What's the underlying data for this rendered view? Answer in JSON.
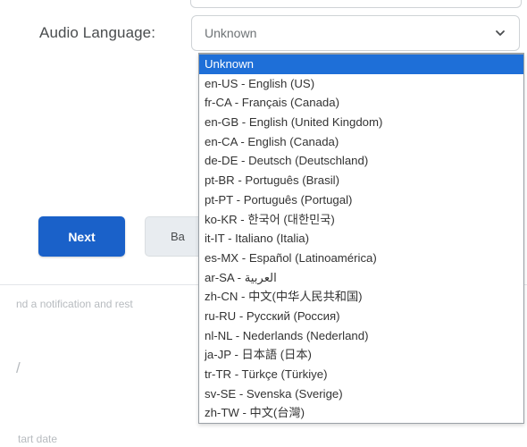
{
  "field": {
    "label": "Audio Language:",
    "selected_value": "Unknown"
  },
  "dropdown": {
    "options": [
      {
        "label": "Unknown",
        "selected": true
      },
      {
        "label": "en-US - English (US)"
      },
      {
        "label": "fr-CA - Français (Canada)"
      },
      {
        "label": "en-GB - English (United Kingdom)"
      },
      {
        "label": "en-CA - English (Canada)"
      },
      {
        "label": "de-DE - Deutsch (Deutschland)"
      },
      {
        "label": "pt-BR - Português (Brasil)"
      },
      {
        "label": "pt-PT - Português (Portugal)"
      },
      {
        "label": "ko-KR - 한국어 (대한민국)"
      },
      {
        "label": "it-IT - Italiano (Italia)"
      },
      {
        "label": "es-MX - Español (Latinoamérica)"
      },
      {
        "label": "ar-SA - العربية"
      },
      {
        "label": "zh-CN - 中文(中华人民共和国)"
      },
      {
        "label": "ru-RU - Русский (Россия)"
      },
      {
        "label": "nl-NL - Nederlands (Nederland)"
      },
      {
        "label": "ja-JP - 日本語 (日本)"
      },
      {
        "label": "tr-TR - Türkçe (Türkiye)"
      },
      {
        "label": "sv-SE - Svenska (Sverige)"
      },
      {
        "label": "zh-TW - 中文(台灣)"
      }
    ]
  },
  "buttons": {
    "next_label": "Next",
    "back_label": "Ba"
  },
  "background": {
    "notification_text": "nd a notification and rest",
    "partial_glyph": "/",
    "start_date_text": "tart date"
  },
  "colors": {
    "primary": "#1a61c9",
    "selected_option": "#1e6fd8"
  },
  "icons": {
    "select_chevron": "chevron-down-icon"
  }
}
